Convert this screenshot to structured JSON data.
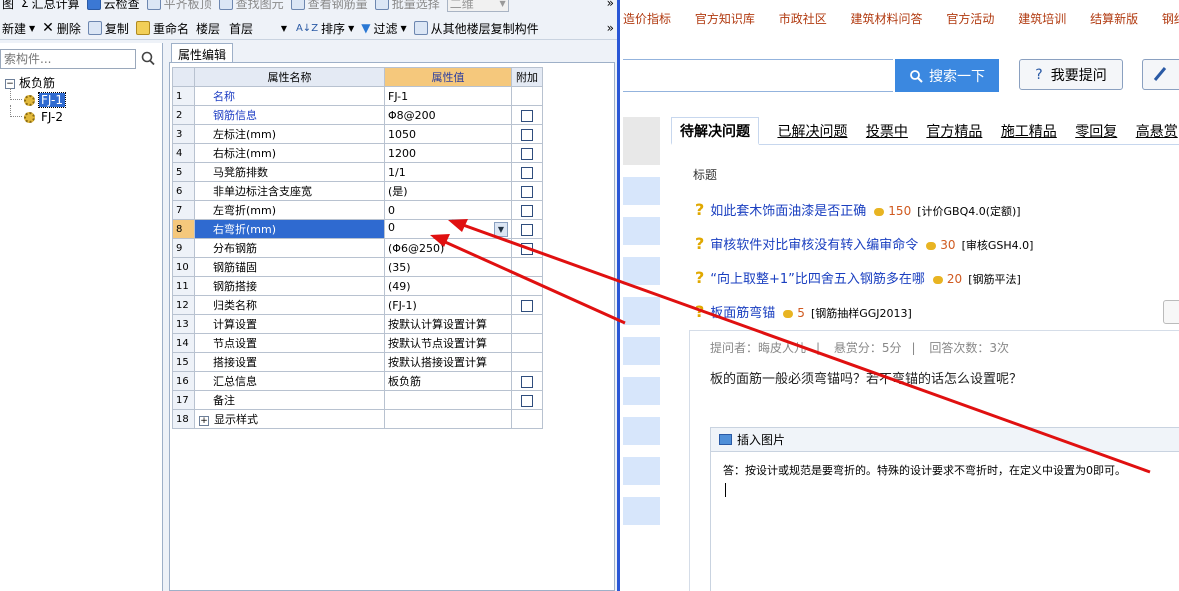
{
  "toolbar1": {
    "item1": "图",
    "summary_calc": "汇总计算",
    "cloud_check": "云检查",
    "flat_board": "平齐板顶",
    "find_element": "查找图元",
    "view_rebar": "查看钢筋量",
    "batch_select": "批量选择",
    "view_mode": "二维",
    "more": "»"
  },
  "toolbar2": {
    "new": "新建",
    "delete": "删除",
    "copy": "复制",
    "rename": "重命名",
    "floor_label": "楼层",
    "floor_value": "首层",
    "sort": "排序",
    "filter": "过滤",
    "copy_from_floor": "从其他楼层复制构件",
    "more": "»"
  },
  "left_panel": {
    "search_placeholder": "索构件...",
    "tree": {
      "root": "板负筋",
      "children": [
        "FJ-1",
        "FJ-2"
      ]
    }
  },
  "prop_panel": {
    "tab": "属性编辑",
    "headers": {
      "name": "属性名称",
      "value": "属性值",
      "extra": "附加"
    },
    "rows": [
      {
        "n": "1",
        "name": "名称",
        "value": "FJ-1"
      },
      {
        "n": "2",
        "name": "钢筋信息",
        "value": "Φ8@200"
      },
      {
        "n": "3",
        "name": "左标注(mm)",
        "value": "1050"
      },
      {
        "n": "4",
        "name": "右标注(mm)",
        "value": "1200"
      },
      {
        "n": "5",
        "name": "马凳筋排数",
        "value": "1/1"
      },
      {
        "n": "6",
        "name": "非单边标注含支座宽",
        "value": "(是)"
      },
      {
        "n": "7",
        "name": "左弯折(mm)",
        "value": "0"
      },
      {
        "n": "8",
        "name": "右弯折(mm)",
        "value": "0"
      },
      {
        "n": "9",
        "name": "分布钢筋",
        "value": "(Φ6@250)"
      },
      {
        "n": "10",
        "name": "钢筋锚固",
        "value": "(35)"
      },
      {
        "n": "11",
        "name": "钢筋搭接",
        "value": "(49)"
      },
      {
        "n": "12",
        "name": "归类名称",
        "value": "(FJ-1)"
      },
      {
        "n": "13",
        "name": "计算设置",
        "value": "按默认计算设置计算"
      },
      {
        "n": "14",
        "name": "节点设置",
        "value": "按默认节点设置计算"
      },
      {
        "n": "15",
        "name": "搭接设置",
        "value": "按默认搭接设置计算"
      },
      {
        "n": "16",
        "name": "汇总信息",
        "value": "板负筋"
      },
      {
        "n": "17",
        "name": "备注",
        "value": ""
      },
      {
        "n": "18",
        "name": "显示样式",
        "value": ""
      }
    ]
  },
  "web": {
    "nav": [
      "造价指标",
      "官方知识库",
      "市政社区",
      "建筑材料问答",
      "官方活动",
      "建筑培训",
      "结算新版",
      "钢结构"
    ],
    "search_button": "搜索一下",
    "ask_button": "我要提问",
    "tabs": [
      "待解决问题",
      "已解决问题",
      "投票中",
      "官方精品",
      "施工精品",
      "零回复",
      "高悬赏"
    ],
    "title_label": "标题",
    "questions": [
      {
        "title": "如此套木饰面油漆是否正确",
        "reward": "150",
        "tag": "[计价GBQ4.0(定额)]"
      },
      {
        "title": "审核软件对比审核没有转入编审命令",
        "reward": "30",
        "tag": "[审核GSH4.0]"
      },
      {
        "title": "“向上取整+1”比四舍五入钢筋多在哪",
        "reward": "20",
        "tag": "[钢筋平法]"
      },
      {
        "title": "板面筋弯锚",
        "reward": "5",
        "tag": "[钢筋抽样GGJ2013]"
      }
    ],
    "detail": {
      "asker": "提问者：晦皮人儿",
      "bounty": "悬赏分：5分",
      "answers": "回答次数：3次",
      "question": "板的面筋一般必须弯锚吗？若不弯锚的话怎么设置呢？",
      "insert_image": "插入图片",
      "answer": "答：按设计或规范是要弯折的。特殊的设计要求不弯折时，在定义中设置为0即可。"
    }
  }
}
